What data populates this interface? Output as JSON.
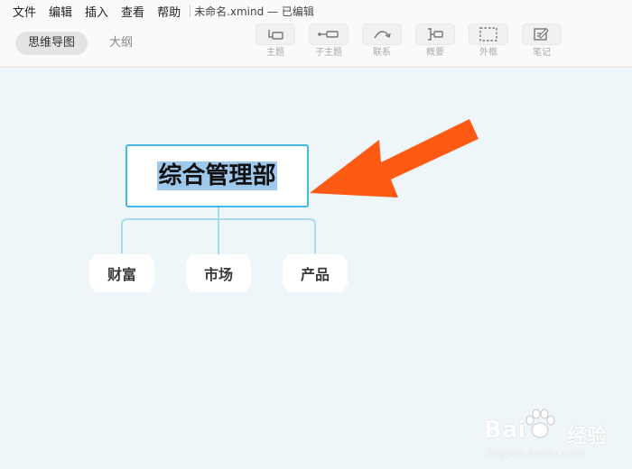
{
  "menubar": {
    "items": [
      "文件",
      "编辑",
      "插入",
      "查看",
      "帮助"
    ],
    "document_title": "未命名.xmind — 已编辑"
  },
  "view_tabs": {
    "mindmap": "思维导图",
    "outline": "大纲"
  },
  "toolbar": {
    "tools": [
      {
        "label": "主题",
        "icon": "topic-icon"
      },
      {
        "label": "子主题",
        "icon": "subtopic-icon"
      },
      {
        "label": "联系",
        "icon": "relationship-icon"
      },
      {
        "label": "概要",
        "icon": "summary-icon"
      },
      {
        "label": "外框",
        "icon": "boundary-icon"
      },
      {
        "label": "笔记",
        "icon": "note-icon"
      }
    ]
  },
  "mindmap": {
    "central_topic": "综合管理部",
    "subtopics": [
      "财富",
      "市场",
      "产品"
    ],
    "colors": {
      "canvas_bg": "#eef6fa",
      "central_border": "#43b8e0",
      "selection_highlight": "#9fc9ec",
      "connector": "#a9dceb",
      "annotation_arrow": "#ff5a14"
    }
  },
  "watermark": {
    "logo": "Bai",
    "brand_cn": "经验",
    "url": "jingyan.baidu.com"
  }
}
